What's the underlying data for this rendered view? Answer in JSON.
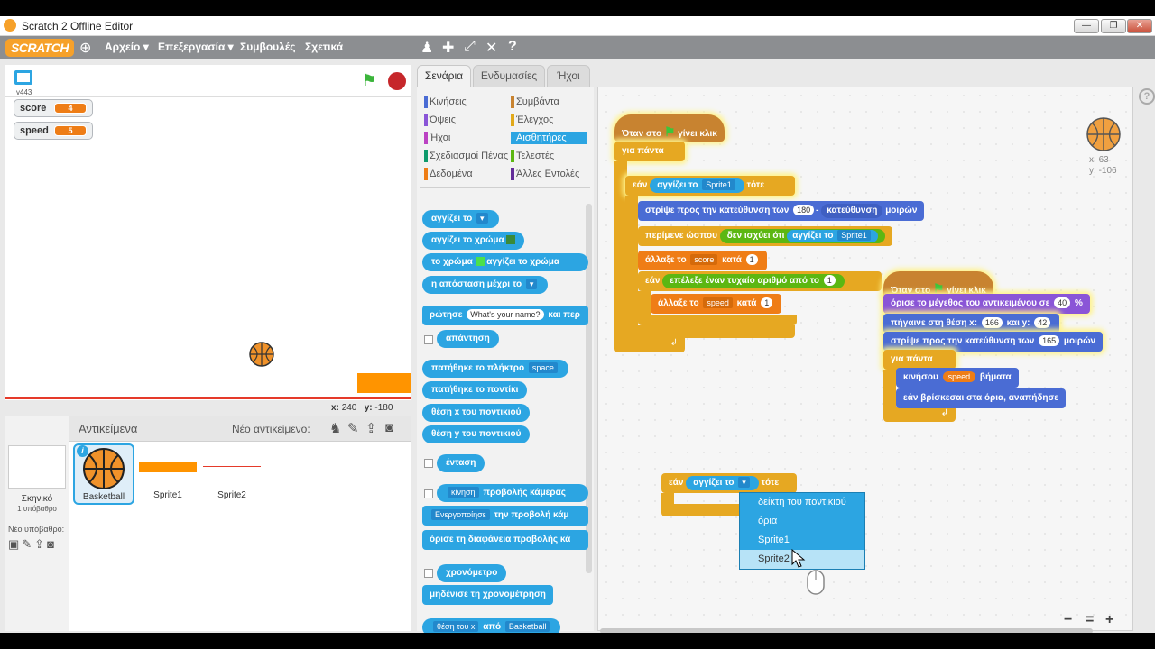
{
  "window": {
    "title": "Scratch 2 Offline Editor"
  },
  "menubar": {
    "logo": "SCRATCH",
    "file": "Αρχείο ▾",
    "edit": "Επεξεργασία ▾",
    "tips": "Συμβουλές",
    "about": "Σχετικά"
  },
  "stage": {
    "version": "v443",
    "mouse_x_label": "x:",
    "mouse_x": "240",
    "mouse_y_label": "y:",
    "mouse_y": "-180"
  },
  "variables": [
    {
      "name": "score",
      "value": "4"
    },
    {
      "name": "speed",
      "value": "5"
    }
  ],
  "sprites_panel": {
    "title": "Αντικείμενα",
    "new_sprite": "Νέο αντικείμενο:",
    "stage_label": "Σκηνικό",
    "stage_sub": "1 υπόβαθρο",
    "new_backdrop": "Νέο υπόβαθρο:",
    "sprites": [
      {
        "name": "Basketball"
      },
      {
        "name": "Sprite1"
      },
      {
        "name": "Sprite2"
      }
    ]
  },
  "tabs": [
    "Σενάρια",
    "Ενδυμασίες",
    "Ήχοι"
  ],
  "categories": {
    "left": [
      "Κινήσεις",
      "Όψεις",
      "Ήχοι",
      "Σχεδιασμοί Πένας",
      "Δεδομένα"
    ],
    "right": [
      "Συμβάντα",
      "Έλεγχος",
      "Αισθητήρες",
      "Τελεστές",
      "Άλλες Εντολές"
    ]
  },
  "palette": {
    "touching": "αγγίζει το",
    "touching_color": "αγγίζει το χρώμα",
    "color_is": "το χρώμα",
    "color_touching": "αγγίζει το χρώμα",
    "distance": "η απόσταση μέχρι το",
    "ask": "ρώτησε",
    "ask_default": "What's your name?",
    "ask_wait": "και περ",
    "answer": "απάντηση",
    "key_pressed": "πατήθηκε το πλήκτρο",
    "key": "space",
    "mouse_down": "πατήθηκε το ποντίκι",
    "mouse_x": "θέση x του ποντικιού",
    "mouse_y": "θέση y του ποντικιού",
    "loudness": "ένταση",
    "video_motion": "κίνηση",
    "video_on": "προβολής κάμερας",
    "turn_video": "Ενεργοποίησε",
    "video_state": "την προβολή κάμ",
    "transparency": "όρισε τη διαφάνεια προβολής κά",
    "timer": "χρονόμετρο",
    "reset_timer": "μηδένισε τη χρονομέτρηση",
    "of_attr": "θέση του x",
    "of": "από",
    "of_sprite": "Basketball"
  },
  "script1": {
    "hat_pre": "Όταν στο",
    "hat_post": "γίνει κλικ",
    "forever": "για πάντα",
    "if": "εάν",
    "then": "τότε",
    "touching": "αγγίζει το",
    "sprite1": "Sprite1",
    "point": "στρίψε προς την κατεύθυνση των",
    "val180": "180",
    "minus": "-",
    "direction": "κατεύθυνση",
    "degrees": "μοιρών",
    "wait_until": "περίμενε ώσπου",
    "not": "δεν ισχύει ότι",
    "change": "άλλαξε το",
    "score": "score",
    "by": "κατά",
    "one": "1",
    "random": "επέλεξε έναν τυχαίο αριθμό από το",
    "speed": "speed"
  },
  "script2": {
    "hat_pre": "Όταν στο",
    "hat_post": "γίνει κλικ",
    "set_size": "όρισε το μέγεθος του αντικειμένου σε",
    "size": "40",
    "pct": "%",
    "goto": "πήγαινε στη θέση x:",
    "x": "166",
    "y_label": "και y:",
    "y": "42",
    "point": "στρίψε προς την κατεύθυνση των",
    "dir": "165",
    "degrees": "μοιρών",
    "forever": "για πάντα",
    "move": "κινήσου",
    "speed": "speed",
    "steps": "βήματα",
    "bounce": "εάν βρίσκεσαι στα όρια, αναπήδησε"
  },
  "script3": {
    "if": "εάν",
    "touching": "αγγίζει το",
    "then": "τότε"
  },
  "dropdown": {
    "items": [
      "δείκτη του ποντικιού",
      "όρια",
      "Sprite1",
      "Sprite2"
    ],
    "highlighted": 3
  },
  "sprite_info": {
    "x_label": "x:",
    "x": "63",
    "y_label": "y:",
    "y": "-106"
  },
  "zoom": {
    "out": "−",
    "reset": "=",
    "in": "+"
  }
}
